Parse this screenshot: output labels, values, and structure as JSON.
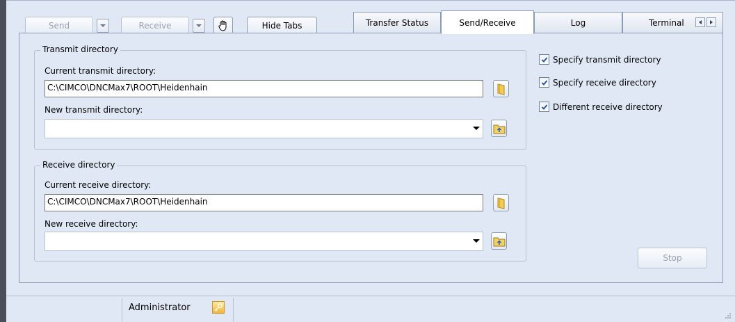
{
  "toolbar": {
    "send_label": "Send",
    "receive_label": "Receive",
    "hide_tabs_label": "Hide Tabs"
  },
  "tabs": [
    {
      "label": "Transfer Status",
      "active": false
    },
    {
      "label": "Send/Receive",
      "active": true
    },
    {
      "label": "Log",
      "active": false
    },
    {
      "label": "Terminal",
      "active": false
    }
  ],
  "transmit": {
    "group_label": "Transmit directory",
    "current_label": "Current transmit directory:",
    "current_value": "C:\\CIMCO\\DNCMax7\\ROOT\\Heidenhain",
    "new_label": "New transmit directory:",
    "new_value": ""
  },
  "receive": {
    "group_label": "Receive directory",
    "current_label": "Current receive directory:",
    "current_value": "C:\\CIMCO\\DNCMax7\\ROOT\\Heidenhain",
    "new_label": "New receive directory:",
    "new_value": ""
  },
  "options": [
    {
      "label": "Specify transmit directory",
      "checked": true
    },
    {
      "label": "Specify receive directory",
      "checked": true
    },
    {
      "label": "Different receive directory",
      "checked": true
    }
  ],
  "stop_label": "Stop",
  "status": {
    "user": "Administrator"
  },
  "colors": {
    "accent": "#3f6fb5",
    "panel_bg": "#dfe8f4",
    "frame": "#4a4e58"
  }
}
